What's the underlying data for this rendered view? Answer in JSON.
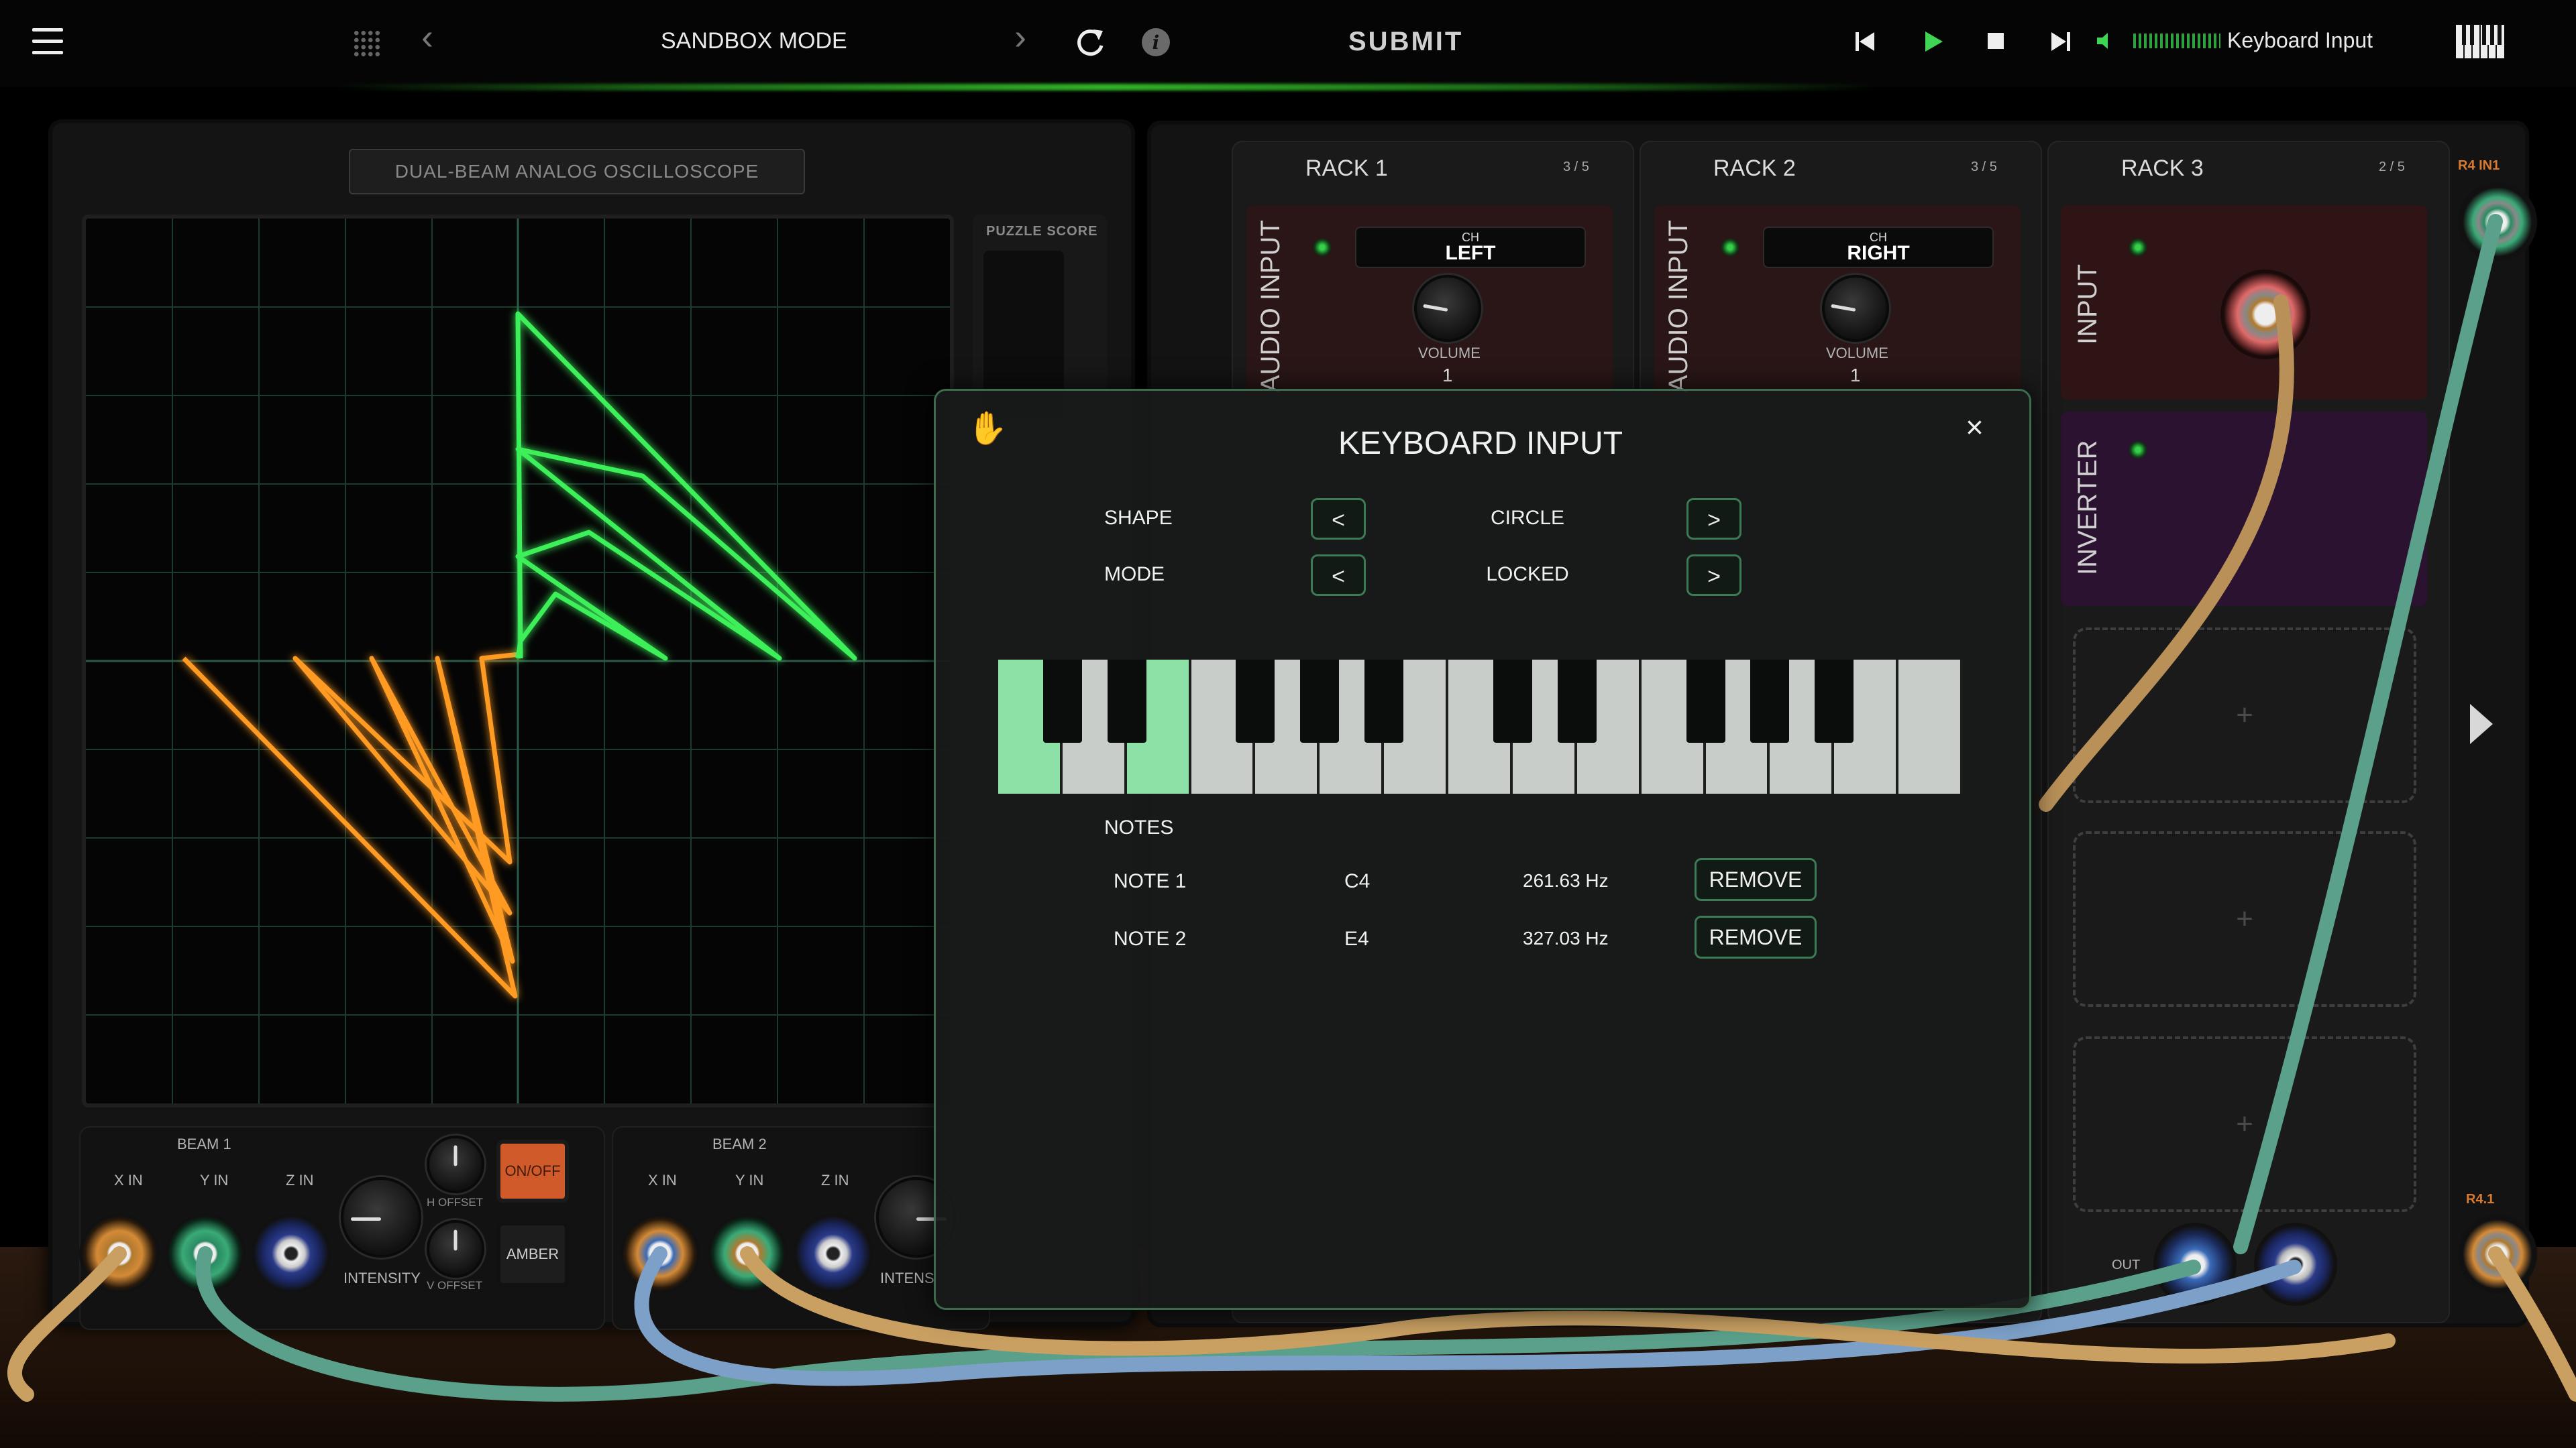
{
  "topbar": {
    "mode_title": "SANDBOX MODE",
    "submit_label": "SUBMIT",
    "audio_source": "Keyboard Input"
  },
  "oscilloscope": {
    "label": "DUAL-BEAM ANALOG OSCILLOSCOPE",
    "puzzle_score_label": "PUZZLE SCORE",
    "beam1": {
      "title": "BEAM 1",
      "x_in": "X IN",
      "y_in": "Y IN",
      "z_in": "Z IN",
      "intensity": "INTENSITY",
      "h_offset": "H OFFSET",
      "v_offset": "V OFFSET",
      "onoff": "ON/OFF",
      "amber": "AMBER"
    },
    "beam2": {
      "title": "BEAM 2",
      "x_in": "X IN",
      "y_in": "Y IN",
      "z_in": "Z IN",
      "intensity": "INTENS"
    },
    "colors": {
      "beam1": "#ff8a1a",
      "beam2": "#3df05a",
      "grid": "#1f3a30"
    }
  },
  "racks": [
    {
      "title": "RACK 1",
      "count": "3 / 5",
      "module": {
        "label": "AUDIO INPUT",
        "ch_label": "CH",
        "ch_value": "LEFT",
        "volume_label": "VOLUME",
        "volume_value": "1"
      }
    },
    {
      "title": "RACK 2",
      "count": "3 / 5",
      "module": {
        "label": "AUDIO INPUT",
        "ch_label": "CH",
        "ch_value": "RIGHT",
        "volume_label": "VOLUME",
        "volume_value": "1"
      }
    },
    {
      "title": "RACK 3",
      "count": "2 / 5",
      "modules": [
        "INPUT",
        "INVERTER"
      ],
      "out_label": "OUT",
      "empty_slot_symbol": "+"
    }
  ],
  "ports": {
    "r4_in1": "R4 IN1",
    "r4_1": "R4.1"
  },
  "modal": {
    "title": "KEYBOARD INPUT",
    "shape_label": "SHAPE",
    "shape_value": "CIRCLE",
    "mode_label": "MODE",
    "mode_value": "LOCKED",
    "prev_symbol": "<",
    "next_symbol": ">",
    "close_symbol": "×",
    "notes_label": "NOTES",
    "notes": [
      {
        "name": "NOTE 1",
        "pitch": "C4",
        "freq": "261.63 Hz",
        "remove": "REMOVE"
      },
      {
        "name": "NOTE 2",
        "pitch": "E4",
        "freq": "327.03 Hz",
        "remove": "REMOVE"
      }
    ],
    "keyboard_active_white_keys": [
      0,
      2
    ]
  }
}
